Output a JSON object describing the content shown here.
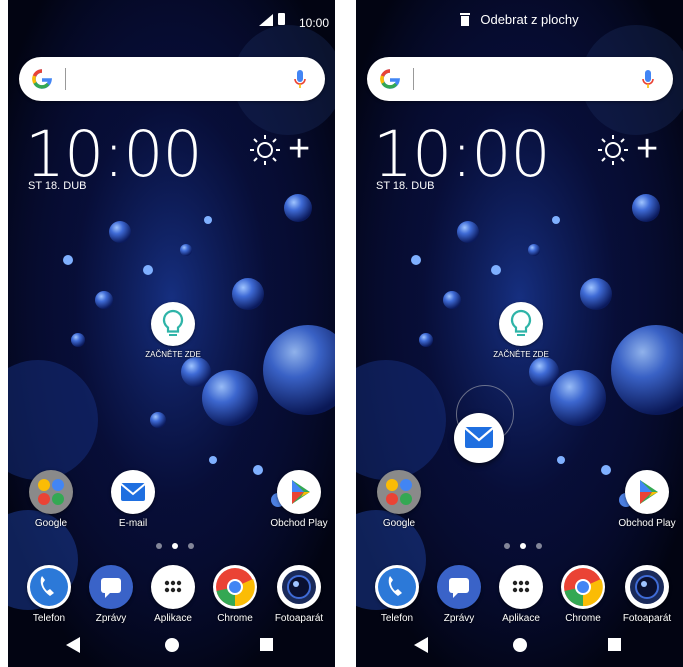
{
  "status_bar": {
    "time": "10:00"
  },
  "drag_banner": {
    "label": "Odebrat z plochy"
  },
  "clock": {
    "time": "10:00",
    "date": "ST 18. DUB"
  },
  "weather": {
    "plus": "+"
  },
  "start_here": {
    "label": "ZAČNĚTE ZDE"
  },
  "home_apps": [
    {
      "label": "Google"
    },
    {
      "label": "E-mail"
    },
    {
      "label": "Obchod Play"
    }
  ],
  "dock_apps": [
    {
      "label": "Telefon"
    },
    {
      "label": "Zprávy"
    },
    {
      "label": "Aplikace"
    },
    {
      "label": "Chrome"
    },
    {
      "label": "Fotoaparát"
    }
  ],
  "page_indicator": {
    "pages": 3,
    "current": 2
  },
  "colors": {
    "wallpaper_dark": "#020412",
    "bubble_blue": "#3f6bd6",
    "email_blue": "#1f6fe0",
    "phone_blue": "#2c79d8",
    "messages_blue": "#3a63c8",
    "bulb_teal": "#2fb4a8"
  }
}
